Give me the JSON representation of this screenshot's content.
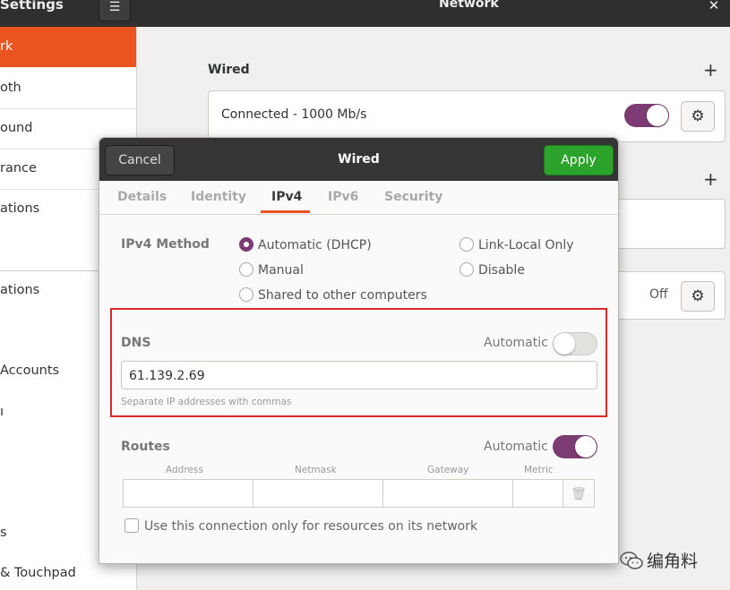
{
  "header": {
    "app_title": "Settings",
    "menu_icon": "hamburger-icon",
    "page_title": "Network",
    "close_icon": "close-icon"
  },
  "sidebar": {
    "items": [
      {
        "label": "rk",
        "active": true
      },
      {
        "label": "oth"
      },
      {
        "label": "ound"
      },
      {
        "label": "rance"
      },
      {
        "label": "ations"
      },
      {
        "label": "ations"
      },
      {
        "label": "Accounts"
      },
      {
        "label": "ı"
      },
      {
        "label": "s"
      },
      {
        "label": "& Touchpad"
      }
    ]
  },
  "main": {
    "wired_title": "Wired",
    "add_symbol": "+",
    "connection_label": "Connected - 1000 Mb/s",
    "connection_on": true,
    "second_add_symbol": "+",
    "off_label": "Off"
  },
  "dialog": {
    "cancel_label": "Cancel",
    "title": "Wired",
    "apply_label": "Apply",
    "tabs": [
      "Details",
      "Identity",
      "IPv4",
      "IPv6",
      "Security"
    ],
    "active_tab": "IPv4",
    "ipv4_method_label": "IPv4 Method",
    "methods": {
      "automatic": "Automatic (DHCP)",
      "link_local": "Link-Local Only",
      "manual": "Manual",
      "disable": "Disable",
      "shared": "Shared to other computers"
    },
    "selected_method": "Automatic (DHCP)",
    "dns": {
      "label": "DNS",
      "automatic_label": "Automatic",
      "automatic_on": false,
      "value": "61.139.2.69",
      "hint": "Separate IP addresses with commas"
    },
    "routes": {
      "label": "Routes",
      "automatic_label": "Automatic",
      "automatic_on": true,
      "columns": [
        "Address",
        "Netmask",
        "Gateway",
        "Metric"
      ]
    },
    "only_resources_label": "Use this connection only for resources on its network"
  },
  "watermark": {
    "text": "编角料"
  },
  "colors": {
    "accent": "#e95420",
    "toggle_on": "#7c3b72",
    "apply": "#2ca42c",
    "highlight_box": "#e0282a"
  }
}
